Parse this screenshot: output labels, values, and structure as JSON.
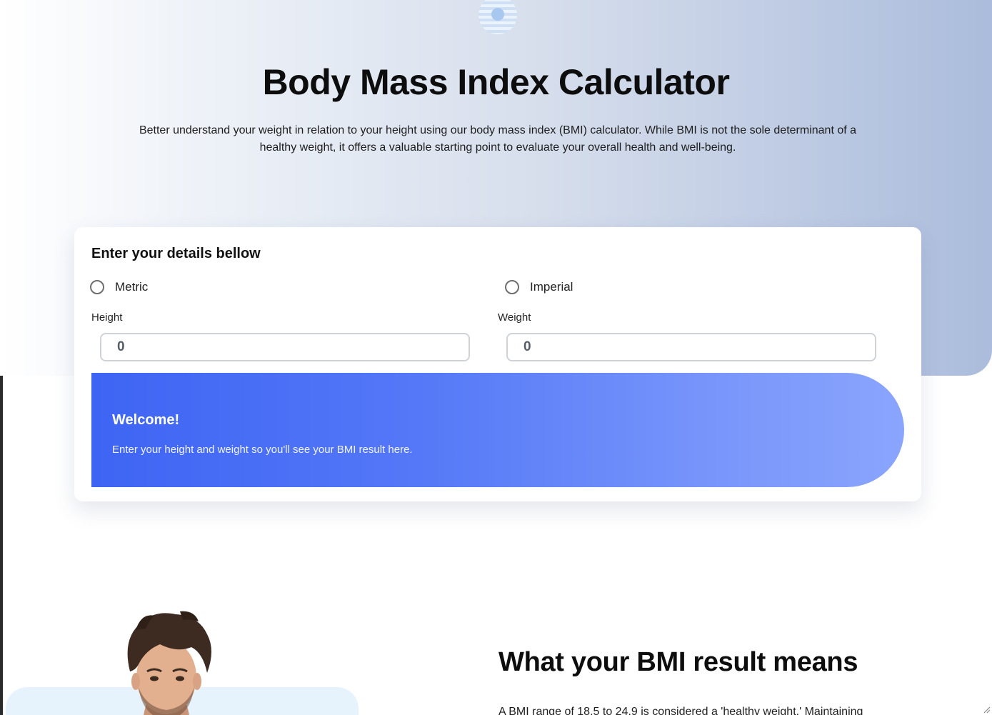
{
  "hero": {
    "title": "Body Mass Index Calculator",
    "description": "Better understand your weight in relation to your height using our body mass index (BMI) calculator. While BMI is not the sole determinant of a healthy weight, it offers a valuable starting point to evaluate your overall health and well-being."
  },
  "calculator": {
    "heading": "Enter your details bellow",
    "units": [
      {
        "label": "Metric",
        "selected": false
      },
      {
        "label": "Imperial",
        "selected": false
      }
    ],
    "height": {
      "label": "Height",
      "placeholder": "0"
    },
    "weight": {
      "label": "Weight",
      "placeholder": "0"
    }
  },
  "result": {
    "title": "Welcome!",
    "message": "Enter your height and weight so you'll see your BMI result here."
  },
  "meaning": {
    "title": "What your BMI result means",
    "text_partial": "A BMI range of 18.5 to 24.9 is considered a 'healthy weight.' Maintaining"
  },
  "colors": {
    "accent": "#3e64f4",
    "accent_light": "#8aa5fd",
    "hero_gradient_end": "#abbcdc"
  },
  "icons": {
    "logo": "logo-icon",
    "person_image": "person-photo"
  }
}
